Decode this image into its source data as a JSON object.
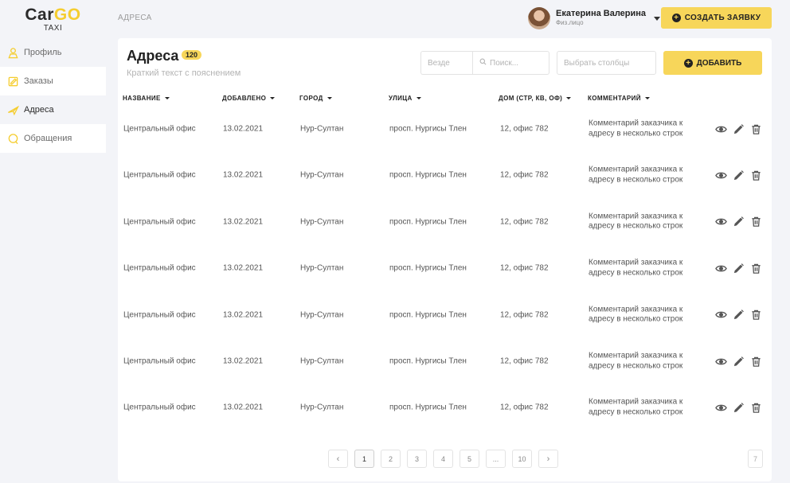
{
  "logo": {
    "part1": "Car",
    "part2": "GO",
    "sub": "TAXI"
  },
  "sidebar": {
    "items": [
      {
        "label": "Профиль",
        "icon": "user-icon"
      },
      {
        "label": "Заказы",
        "icon": "orders-icon"
      },
      {
        "label": "Адреса",
        "icon": "pin-icon",
        "active": true
      },
      {
        "label": "Обращения",
        "icon": "chat-icon"
      }
    ]
  },
  "header": {
    "breadcrumb": "АДРЕСА",
    "user_name": "Екатерина Валерина",
    "user_type": "Физ.лицо",
    "create_label": "СОЗДАТЬ ЗАЯВКУ"
  },
  "main": {
    "title": "Адреса",
    "count": "120",
    "subtitle": "Краткий текст с пояснением",
    "scope_placeholder": "Везде",
    "search_placeholder": "Поиск...",
    "columns_placeholder": "Выбрать столбцы",
    "add_label": "ДОБАВИТЬ",
    "columns": [
      "НАЗВАНИЕ",
      "ДОБАВЛЕНО",
      "ГОРОД",
      "УЛИЦА",
      "ДОМ (СТР, КВ, ОФ)",
      "КОММЕНТАРИЙ"
    ],
    "rows": [
      {
        "name": "Центральный офис",
        "added": "13.02.2021",
        "city": "Нур-Султан",
        "street": "просп. Нургисы Тлен",
        "house": "12, офис 782",
        "comment": "Комментарий заказчика к адресу в несколько строк"
      },
      {
        "name": "Центральный офис",
        "added": "13.02.2021",
        "city": "Нур-Султан",
        "street": "просп. Нургисы Тлен",
        "house": "12, офис 782",
        "comment": "Комментарий заказчика к адресу в несколько строк"
      },
      {
        "name": "Центральный офис",
        "added": "13.02.2021",
        "city": "Нур-Султан",
        "street": "просп. Нургисы Тлен",
        "house": "12, офис 782",
        "comment": "Комментарий заказчика к адресу в несколько строк"
      },
      {
        "name": "Центральный офис",
        "added": "13.02.2021",
        "city": "Нур-Султан",
        "street": "просп. Нургисы Тлен",
        "house": "12, офис 782",
        "comment": "Комментарий заказчика к адресу в несколько строк"
      },
      {
        "name": "Центральный офис",
        "added": "13.02.2021",
        "city": "Нур-Султан",
        "street": "просп. Нургисы Тлен",
        "house": "12, офис 782",
        "comment": "Комментарий заказчика к адресу в несколько строк"
      },
      {
        "name": "Центральный офис",
        "added": "13.02.2021",
        "city": "Нур-Султан",
        "street": "просп. Нургисы Тлен",
        "house": "12, офис 782",
        "comment": "Комментарий заказчика к адресу в несколько строк"
      },
      {
        "name": "Центральный офис",
        "added": "13.02.2021",
        "city": "Нур-Султан",
        "street": "просп. Нургисы Тлен",
        "house": "12, офис 782",
        "comment": "Комментарий заказчика к адресу в несколько строк"
      }
    ],
    "row_actions": [
      "view-icon",
      "edit-icon",
      "delete-icon"
    ]
  },
  "pagination": {
    "prev": "‹",
    "next": "›",
    "pages": [
      "1",
      "2",
      "3",
      "4",
      "5",
      "...",
      "10"
    ],
    "current": "1",
    "page_size": "7"
  },
  "colors": {
    "accent": "#f7d65a",
    "logo_accent": "#f5cd2f",
    "text": "#222222",
    "muted": "#b4b4b4"
  }
}
